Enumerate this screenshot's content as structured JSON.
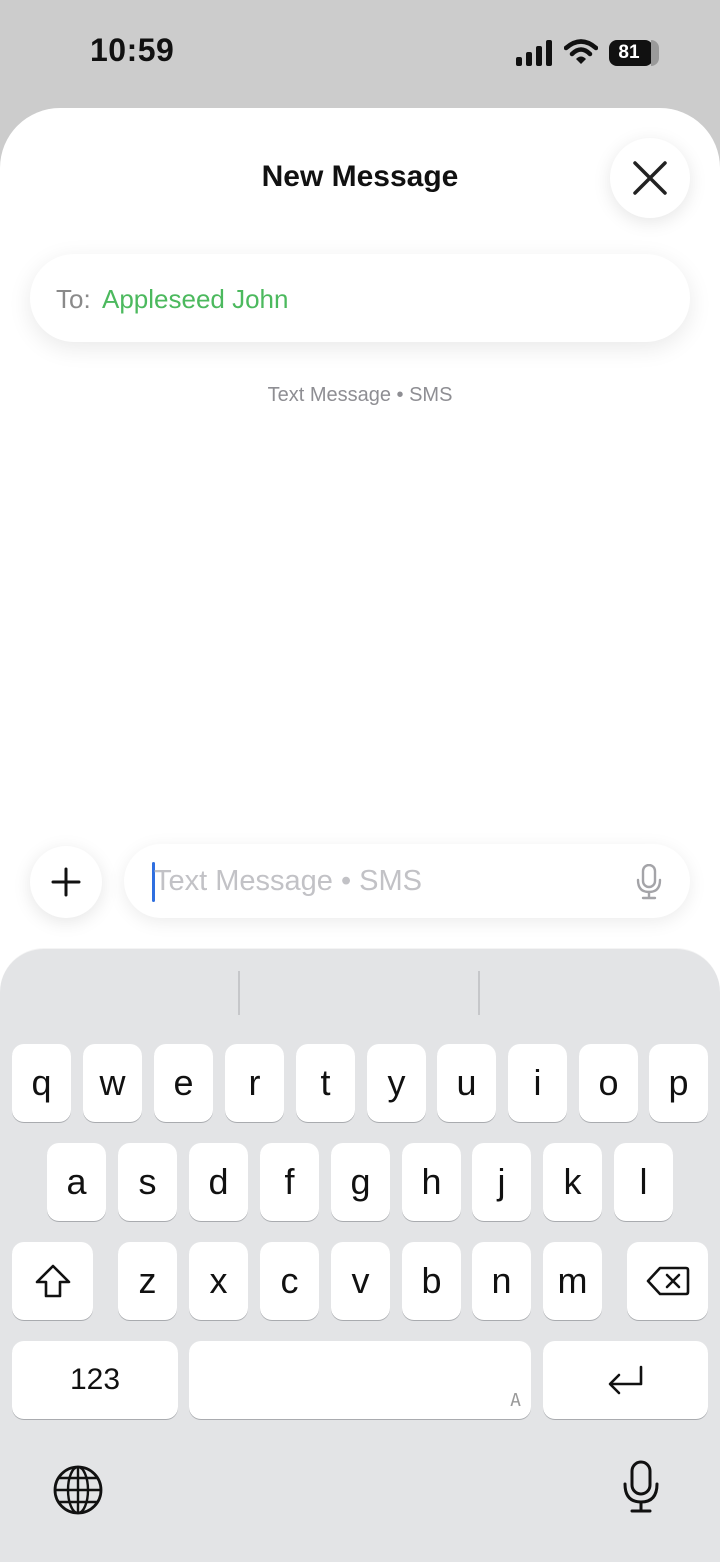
{
  "status_bar": {
    "time": "10:59",
    "battery_level": "81",
    "signal_icon": "signal-bars-icon",
    "wifi_icon": "wifi-icon"
  },
  "sheet": {
    "title": "New Message",
    "close_icon": "close-icon"
  },
  "recipients": {
    "label": "To:",
    "name": "Appleseed John",
    "name_color": "#4cb95e"
  },
  "conversation": {
    "service_caption": "Text Message • SMS"
  },
  "composer": {
    "add_icon": "plus-icon",
    "placeholder": "Text Message • SMS",
    "mic_icon": "microphone-icon"
  },
  "keyboard": {
    "row1": [
      "q",
      "w",
      "e",
      "r",
      "t",
      "y",
      "u",
      "i",
      "o",
      "p"
    ],
    "row2": [
      "a",
      "s",
      "d",
      "f",
      "g",
      "h",
      "j",
      "k",
      "l"
    ],
    "row3": [
      "z",
      "x",
      "c",
      "v",
      "b",
      "n",
      "m"
    ],
    "shift_icon": "shift-icon",
    "delete_icon": "delete-backspace-icon",
    "numbers_label": "123",
    "space_language": "A",
    "return_icon": "return-icon",
    "globe_icon": "globe-icon",
    "dictation_icon": "microphone-icon"
  }
}
